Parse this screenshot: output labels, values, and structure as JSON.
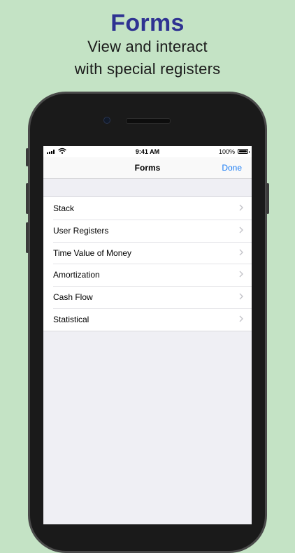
{
  "promo": {
    "headline": "Forms",
    "subline1": "View and interact",
    "subline2": "with special registers"
  },
  "statusbar": {
    "time": "9:41 AM",
    "battery": "100%"
  },
  "navbar": {
    "title": "Forms",
    "done_label": "Done"
  },
  "forms_list": {
    "items": [
      {
        "label": "Stack"
      },
      {
        "label": "User Registers"
      },
      {
        "label": "Time Value of Money"
      },
      {
        "label": "Amortization"
      },
      {
        "label": "Cash Flow"
      },
      {
        "label": "Statistical"
      }
    ]
  },
  "colors": {
    "background": "#c4e3c5",
    "headline": "#2f3392",
    "accent": "#1a7cf4"
  },
  "icons": [
    "signal-icon",
    "wifi-icon",
    "battery-icon",
    "chevron-right-icon"
  ]
}
